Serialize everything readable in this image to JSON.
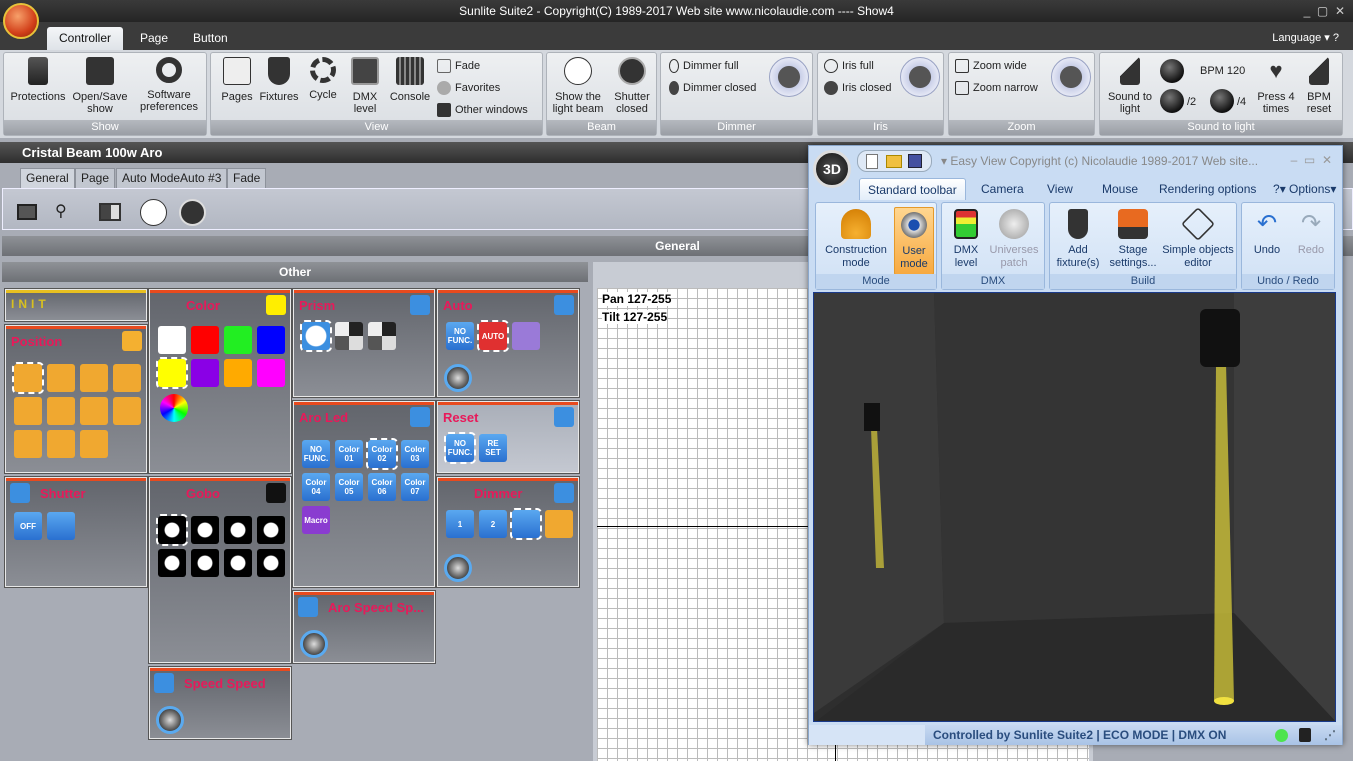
{
  "title": "Sunlite Suite2 - Copyright(C) 1989-2017    Web site www.nicolaudie.com ---- Show4",
  "ribbon_tabs": [
    "Controller",
    "Page",
    "Button"
  ],
  "language": "Language",
  "help": "?",
  "groups": {
    "show": {
      "label": "Show",
      "protections": "Protections",
      "open_save": "Open/Save show",
      "software": "Software preferences"
    },
    "view": {
      "label": "View",
      "pages": "Pages",
      "fixtures": "Fixtures",
      "cycle": "Cycle",
      "dmx": "DMX level",
      "console": "Console",
      "fade": "Fade",
      "favorites": "Favorites",
      "other": "Other windows"
    },
    "beam": {
      "label": "Beam",
      "show_beam": "Show the light beam",
      "shutter": "Shutter closed"
    },
    "dimmer": {
      "label": "Dimmer",
      "full": "Dimmer full",
      "closed": "Dimmer closed"
    },
    "iris": {
      "label": "Iris",
      "full": "Iris full",
      "closed": "Iris closed"
    },
    "zoom": {
      "label": "Zoom",
      "wide": "Zoom wide",
      "narrow": "Zoom narrow"
    },
    "sound": {
      "label": "Sound to light",
      "stl": "Sound to light",
      "bpm": "BPM 120",
      "half": "/2",
      "quarter": "/4",
      "press": "Press 4 times",
      "reset": "BPM reset"
    }
  },
  "fixture": {
    "name": "Cristal Beam 100w Aro",
    "tabs": [
      "General",
      "Page",
      "Auto ModeAuto #3",
      "Fade"
    ],
    "general_header": "General",
    "other_header": "Other"
  },
  "panels": [
    {
      "id": "init",
      "title": "INIT",
      "buttons": []
    },
    {
      "id": "position",
      "title": "Position",
      "buttons": [
        "",
        "",
        "",
        "",
        "",
        "",
        "",
        "",
        "",
        "",
        ""
      ]
    },
    {
      "id": "shutter",
      "title": "Shutter",
      "buttons": [
        "OFF",
        ""
      ]
    },
    {
      "id": "color",
      "title": "Color",
      "swatches": [
        "#ffffff",
        "#ff0000",
        "#22ee22",
        "#0000ff",
        "#ffff00",
        "#8a00e6",
        "#ffaa00",
        "#ff00ff"
      ]
    },
    {
      "id": "gobo",
      "title": "Gobo",
      "buttons": [
        "",
        "",
        "",
        "",
        "",
        "",
        "",
        ""
      ]
    },
    {
      "id": "speed",
      "title": "Speed Speed"
    },
    {
      "id": "prism",
      "title": "Prism",
      "buttons": [
        "",
        "",
        ""
      ]
    },
    {
      "id": "aroled",
      "title": "Aro Led",
      "buttons": [
        "NO FUNC.",
        "Color 01",
        "Color 02",
        "Color 03",
        "Color 04",
        "Color 05",
        "Color 06",
        "Color 07",
        "Macro"
      ]
    },
    {
      "id": "arospeed",
      "title": "Aro Speed Sp..."
    },
    {
      "id": "auto",
      "title": "Auto",
      "buttons": [
        "NO FUNC.",
        "AUTO",
        ""
      ]
    },
    {
      "id": "reset",
      "title": "Reset",
      "buttons": [
        "NO FUNC.",
        "RE SET"
      ]
    },
    {
      "id": "dimmer",
      "title": "Dimmer",
      "buttons": [
        "1",
        "2",
        "",
        ""
      ]
    }
  ],
  "grid": {
    "pan": "Pan 127-255",
    "tilt": "Tilt 127-255"
  },
  "easyview": {
    "title": "Easy View   Copyright (c) Nicolaudie 1989-2017   Web site...",
    "logo": "3D",
    "tabs": [
      "Standard toolbar",
      "Camera",
      "View",
      "Mouse",
      "Rendering options"
    ],
    "help": "?",
    "options": "Options",
    "mode": {
      "label": "Mode",
      "construction": "Construction mode",
      "user": "User mode"
    },
    "dmx": {
      "label": "DMX",
      "level": "DMX level",
      "patch": "Universes patch"
    },
    "build": {
      "label": "Build",
      "add": "Add fixture(s)",
      "stage": "Stage settings...",
      "simple": "Simple objects editor"
    },
    "undo": {
      "label": "Undo / Redo",
      "undo": "Undo",
      "redo": "Redo"
    },
    "status": "Controlled by Sunlite Suite2  |  ECO MODE  |  DMX ON"
  }
}
